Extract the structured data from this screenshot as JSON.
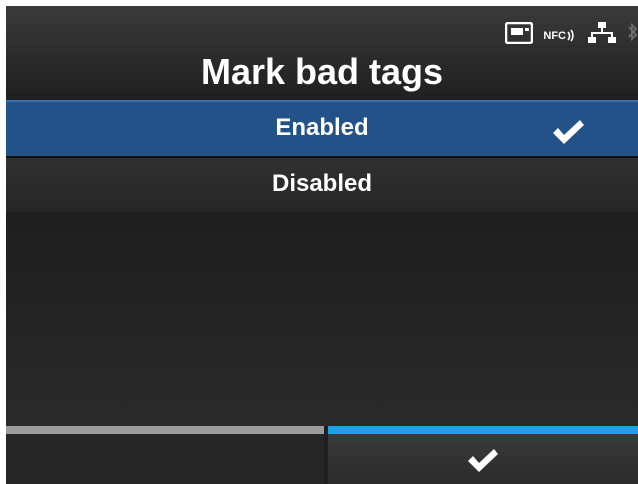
{
  "header": {
    "title": "Mark bad tags",
    "status_icons": [
      "sd-card-icon",
      "nfc-icon",
      "network-icon",
      "bluetooth-icon"
    ],
    "nfc_label": "NFC"
  },
  "options": [
    {
      "label": "Enabled",
      "selected": true
    },
    {
      "label": "Disabled",
      "selected": false
    }
  ],
  "footer": {
    "left_key": "",
    "right_key": "confirm-check-icon"
  },
  "colors": {
    "selected_bg": "#235289",
    "accent_blue": "#1aa3e6",
    "background": "#1f1f1f"
  }
}
